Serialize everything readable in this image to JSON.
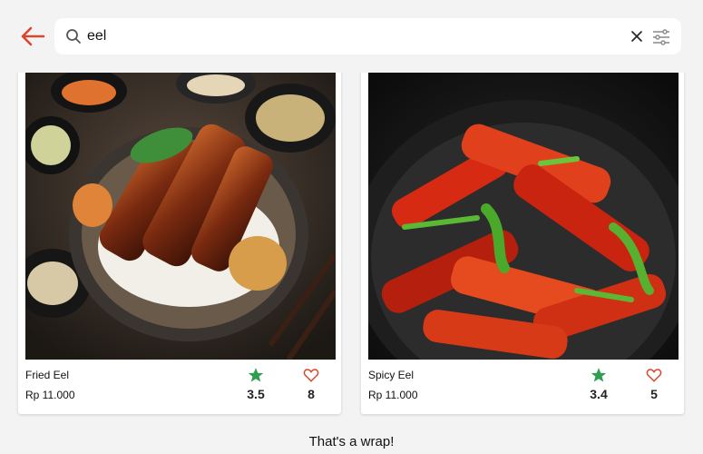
{
  "search": {
    "value": "eel"
  },
  "icons": {
    "back": "arrow-left-icon",
    "search": "search-icon",
    "clear": "close-icon",
    "filter": "filter-sliders-icon",
    "rating": "star-icon",
    "likes": "heart-outline-icon"
  },
  "colors": {
    "accent": "#d9462b",
    "star": "#2e9e4f"
  },
  "results": [
    {
      "name": "Fried Eel",
      "price": "Rp 11.000",
      "rating": "3.5",
      "likes": "8"
    },
    {
      "name": "Spicy Eel",
      "price": "Rp 11.000",
      "rating": "3.4",
      "likes": "5"
    }
  ],
  "footer": {
    "end_text": "That's a wrap!"
  }
}
